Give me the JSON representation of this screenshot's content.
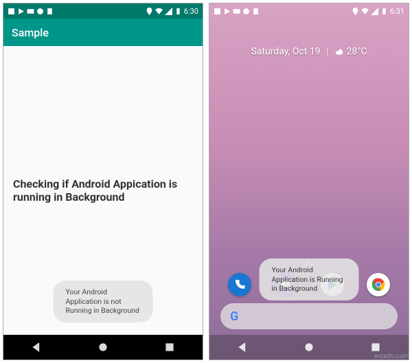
{
  "left": {
    "status": {
      "time": "6:30",
      "icons_left": [
        "square",
        "play",
        "mail",
        "circle",
        "doc"
      ],
      "icons_right": [
        "location",
        "wifi",
        "signal",
        "battery"
      ]
    },
    "app_bar_title": "Sample",
    "body_text": "Checking if Android Appication is running in Background",
    "toast": "Your Android Application is not Running in Background"
  },
  "right": {
    "status": {
      "time": "6:31",
      "icons_left": [
        "square",
        "play",
        "mail",
        "circle",
        "doc"
      ],
      "icons_right": [
        "location",
        "wifi",
        "signal",
        "battery"
      ]
    },
    "date_text": "Saturday, Oct 19",
    "separator": "|",
    "weather_text": "28°C",
    "dock": [
      "phone",
      "messages",
      "play-store",
      "chrome"
    ],
    "search_logo": "G",
    "toast": "Your Android Application is Running in Background"
  },
  "nav": {
    "back": "◀",
    "home": "●",
    "recent": "■"
  },
  "watermark": "wsxdn.com"
}
